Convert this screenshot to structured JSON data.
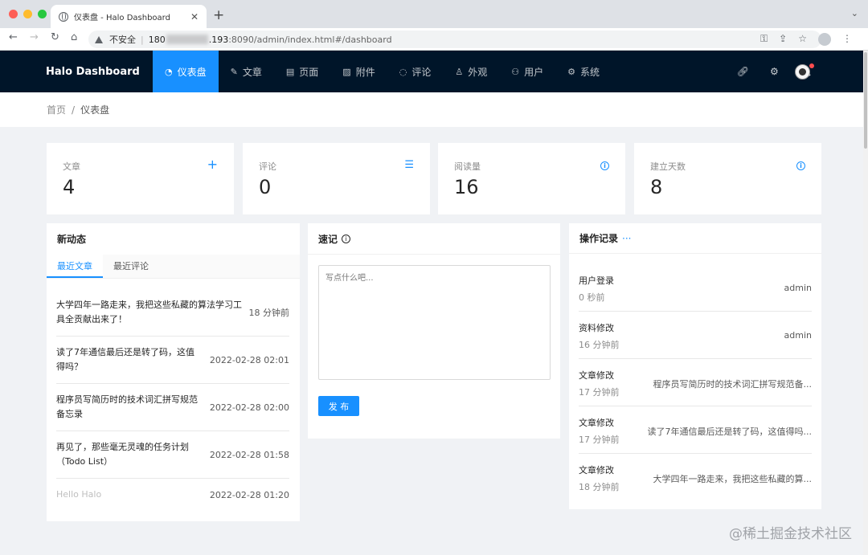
{
  "browser": {
    "tab_title": "仪表盘 - Halo Dashboard",
    "insecure_label": "不安全",
    "url_host_start": "180",
    "url_host_end": ".193",
    "url_path": ":8090/admin/index.html#/dashboard",
    "traffic_colors": [
      "#fe5f57",
      "#febc2e",
      "#28c840"
    ]
  },
  "header": {
    "logo": "Halo  Dashboard",
    "menu": [
      {
        "label": "仪表盘",
        "icon": "dashboard-icon"
      },
      {
        "label": "文章",
        "icon": "edit-icon"
      },
      {
        "label": "页面",
        "icon": "book-icon"
      },
      {
        "label": "附件",
        "icon": "picture-icon"
      },
      {
        "label": "评论",
        "icon": "comment-icon"
      },
      {
        "label": "外观",
        "icon": "skin-icon"
      },
      {
        "label": "用户",
        "icon": "user-icon"
      },
      {
        "label": "系统",
        "icon": "setting-icon"
      }
    ]
  },
  "breadcrumb": {
    "home": "首页",
    "separator": "/",
    "current": "仪表盘"
  },
  "stats": [
    {
      "label": "文章",
      "value": "4",
      "icon": "plus-icon"
    },
    {
      "label": "评论",
      "value": "0",
      "icon": "list-icon"
    },
    {
      "label": "阅读量",
      "value": "16",
      "icon": "info-icon"
    },
    {
      "label": "建立天数",
      "value": "8",
      "icon": "info-icon"
    }
  ],
  "activity": {
    "title": "新动态",
    "tabs": [
      "最近文章",
      "最近评论"
    ],
    "items": [
      {
        "title": "大学四年一路走来，我把这些私藏的算法学习工具全贡献出来了！",
        "time": "18 分钟前"
      },
      {
        "title": "读了7年通信最后还是转了码，这值得吗？",
        "time": "2022-02-28 02:01"
      },
      {
        "title": "程序员写简历时的技术词汇拼写规范备忘录",
        "time": "2022-02-28 02:00"
      },
      {
        "title": "再见了，那些毫无灵魂的任务计划（Todo List）",
        "time": "2022-02-28 01:58"
      },
      {
        "title": "Hello Halo",
        "time": "2022-02-28 01:20"
      }
    ]
  },
  "memo": {
    "title": "速记",
    "placeholder": "写点什么吧...",
    "button": "发 布"
  },
  "logs": {
    "title": "操作记录",
    "items": [
      {
        "type": "用户登录",
        "time": "0 秒前",
        "content": "admin"
      },
      {
        "type": "资料修改",
        "time": "16 分钟前",
        "content": "admin"
      },
      {
        "type": "文章修改",
        "time": "17 分钟前",
        "content": "程序员写简历时的技术词汇拼写规范备..."
      },
      {
        "type": "文章修改",
        "time": "17 分钟前",
        "content": "读了7年通信最后还是转了码，这值得吗..."
      },
      {
        "type": "文章修改",
        "time": "18 分钟前",
        "content": "大学四年一路走来，我把这些私藏的算..."
      }
    ]
  },
  "watermark": "@稀土掘金技术社区"
}
